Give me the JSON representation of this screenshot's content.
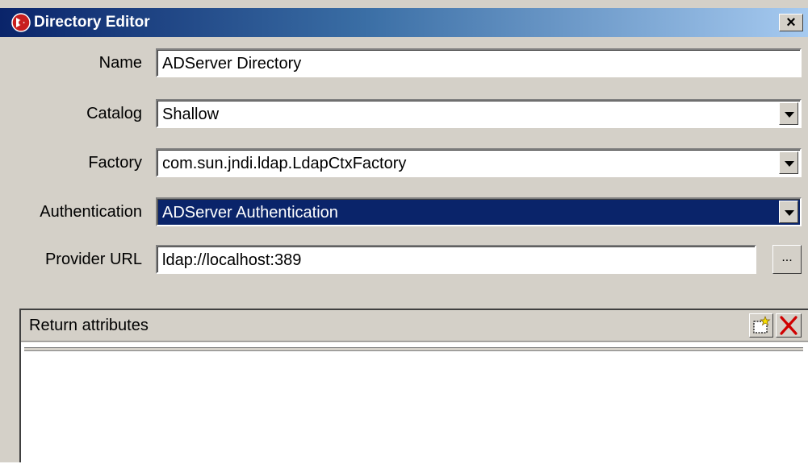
{
  "window": {
    "title": "Directory Editor",
    "close_label": "×"
  },
  "form": {
    "name": {
      "label": "Name",
      "value": "ADServer Directory"
    },
    "catalog": {
      "label": "Catalog",
      "value": "Shallow"
    },
    "factory": {
      "label": "Factory",
      "value": "com.sun.jndi.ldap.LdapCtxFactory"
    },
    "authentication": {
      "label": "Authentication",
      "value": "ADServer Authentication"
    },
    "provider_url": {
      "label": "Provider URL",
      "value": "ldap://localhost:389",
      "browse_label": "..."
    }
  },
  "attributes": {
    "title": "Return attributes",
    "items": []
  },
  "colors": {
    "titlebar": "#0a246a",
    "face": "#d4d0c8",
    "selection": "#0a246a",
    "delete": "#d00000"
  },
  "icons": {
    "app": "app-logo-icon",
    "add": "new-item-icon",
    "delete": "delete-x-icon",
    "dropdown": "chevron-down-icon"
  }
}
